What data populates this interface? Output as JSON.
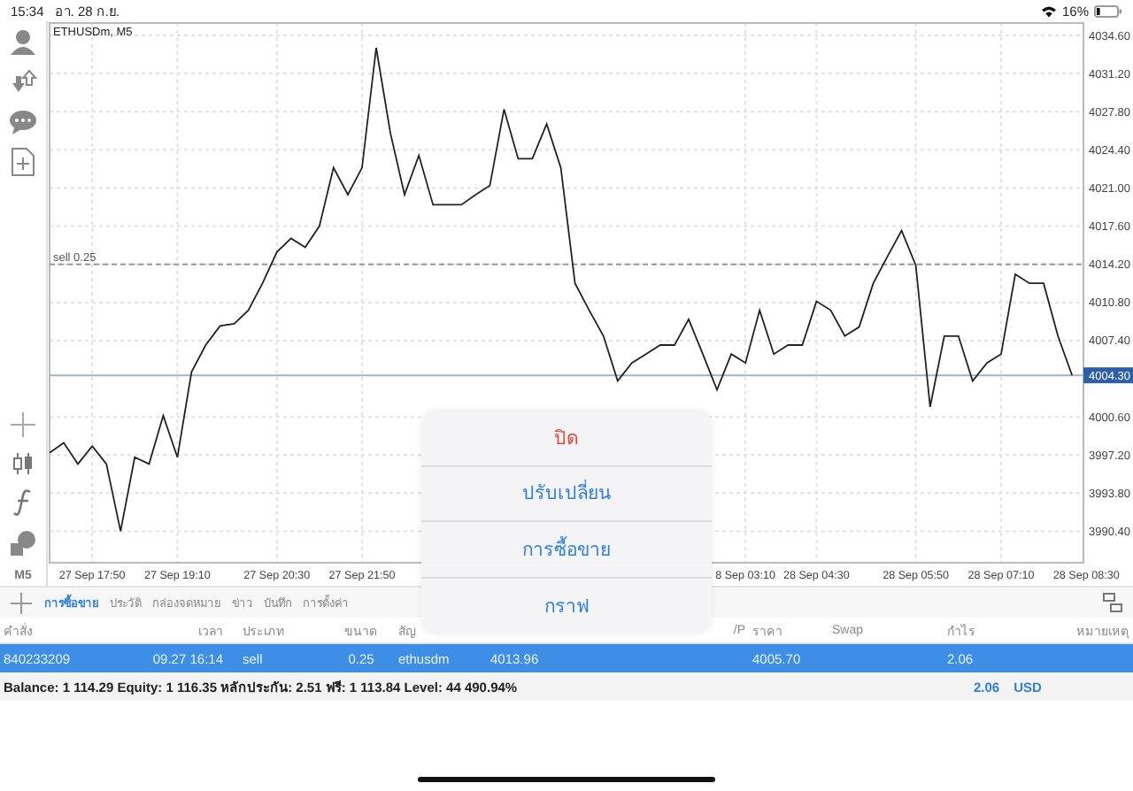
{
  "status_bar": {
    "time": "15:34",
    "date": "อา. 28 ก.ย.",
    "battery": "16%"
  },
  "toolbar": {
    "timeframe": "M5"
  },
  "chart": {
    "chart_data": {
      "type": "line",
      "title": "ETHUSDm, M5",
      "ylim": [
        3987.6,
        4035.7
      ],
      "categories": [
        null,
        null,
        null,
        "27 Sep 17:50",
        null,
        null,
        null,
        null,
        null,
        "27 Sep 19:10",
        null,
        null,
        null,
        null,
        null,
        null,
        "27 Sep 20:30",
        null,
        null,
        null,
        null,
        null,
        "27 Sep 21:50",
        null,
        null,
        null,
        null,
        null,
        null,
        null,
        null,
        null,
        null,
        null,
        null,
        null,
        null,
        null,
        null,
        null,
        null,
        null,
        null,
        null,
        null,
        null,
        null,
        null,
        null,
        "8 Sep 03:10",
        null,
        null,
        null,
        null,
        "28 Sep 04:30",
        null,
        null,
        null,
        null,
        null,
        null,
        "28 Sep 05:50",
        null,
        null,
        null,
        null,
        null,
        "28 Sep 07:10",
        null,
        null,
        null,
        null,
        null,
        "28 Sep 08:30"
      ],
      "yticks": [
        {
          "value": 4034.6,
          "label": "4034.60"
        },
        {
          "value": 4031.2,
          "label": "4031.20"
        },
        {
          "value": 4027.8,
          "label": "4027.80"
        },
        {
          "value": 4024.4,
          "label": "4024.40"
        },
        {
          "value": 4021.0,
          "label": "4021.00"
        },
        {
          "value": 4017.6,
          "label": "4017.60"
        },
        {
          "value": 4014.2,
          "label": "4014.20"
        },
        {
          "value": 4010.8,
          "label": "4010.80"
        },
        {
          "value": 4007.4,
          "label": "4007.40"
        },
        {
          "value": 4000.6,
          "label": "4000.60"
        },
        {
          "value": 3997.2,
          "label": "3997.20"
        },
        {
          "value": 3993.8,
          "label": "3993.80"
        },
        {
          "value": 3990.4,
          "label": "3990.40"
        }
      ],
      "series": [
        {
          "color": "#222222",
          "values": [
            3997.4,
            3998.3,
            3996.4,
            3998.0,
            3996.4,
            3990.4,
            3997.0,
            3996.4,
            4000.7,
            3997.0,
            4004.6,
            4007.0,
            4008.7,
            4008.9,
            4010.1,
            4012.5,
            4015.3,
            4016.5,
            4015.7,
            4017.6,
            4022.8,
            4020.4,
            4022.8,
            4033.5,
            4025.9,
            4020.4,
            4023.9,
            4019.5,
            4019.5,
            4019.5,
            4020.4,
            4021.2,
            4028.0,
            4023.6,
            4023.6,
            4026.7,
            4022.8,
            4012.5,
            4010.1,
            4007.8,
            4003.8,
            4005.4,
            4006.2,
            4007.0,
            4007.0,
            4009.3,
            4006.2,
            4003.0,
            4006.2,
            4005.4,
            4010.1,
            4006.2,
            4007.0,
            4007.0,
            4010.9,
            4010.1,
            4007.8,
            4008.6,
            4012.5,
            4014.9,
            4017.2,
            4014.1,
            4001.5,
            4007.8,
            4007.8,
            4003.8,
            4005.4,
            4006.2,
            4013.3,
            4012.5,
            4012.5,
            4007.8,
            4004.3,
            null
          ]
        }
      ],
      "grid": true,
      "ref_lines": [
        {
          "axis": "y",
          "value": 4014.2,
          "label": "sell 0.25"
        },
        {
          "axis": "y",
          "value": 4004.3,
          "label": "4004.30"
        }
      ]
    }
  },
  "tabs": [
    {
      "label": "การซื้อขาย",
      "selected": true
    },
    {
      "label": "ประวัติ",
      "selected": false
    },
    {
      "label": "กล่องจดหมาย",
      "selected": false
    },
    {
      "label": "ข่าว",
      "selected": false
    },
    {
      "label": "บันทึก",
      "selected": false
    },
    {
      "label": "การตั้งค่า",
      "selected": false
    }
  ],
  "table": {
    "columns": [
      {
        "label": "คำสั่ง"
      },
      {
        "label": "เวลา"
      },
      {
        "label": "ประเภท"
      },
      {
        "label": "ขนาด"
      },
      {
        "label": "สัญ"
      },
      null,
      null,
      {
        "label": "/P"
      },
      {
        "label": "ราคา"
      },
      {
        "label": "Swap"
      },
      {
        "label": "กำไร"
      },
      {
        "label": "หมายเหตุ"
      }
    ],
    "rows": [
      {
        "selected": true,
        "cells": [
          "840233209",
          "09.27 16:14",
          "sell",
          "0.25",
          "ethusdm",
          "4013.96",
          null,
          null,
          "4005.70",
          null,
          "2.06",
          null
        ]
      }
    ]
  },
  "summary": {
    "text": "Balance: 1 114.29 Equity: 1 116.35 หลักประกัน: 2.51 ฟรี: 1 113.84 Level: 44 490.94%",
    "profit": "2.06",
    "currency": "USD"
  },
  "popup": {
    "items": [
      {
        "label": "ปิด",
        "kind": "destructive"
      },
      {
        "label": "ปรับเปลี่ยน",
        "kind": "action"
      },
      {
        "label": "การซื้อขาย",
        "kind": "action"
      },
      {
        "label": "กราฟ",
        "kind": "action"
      }
    ]
  }
}
